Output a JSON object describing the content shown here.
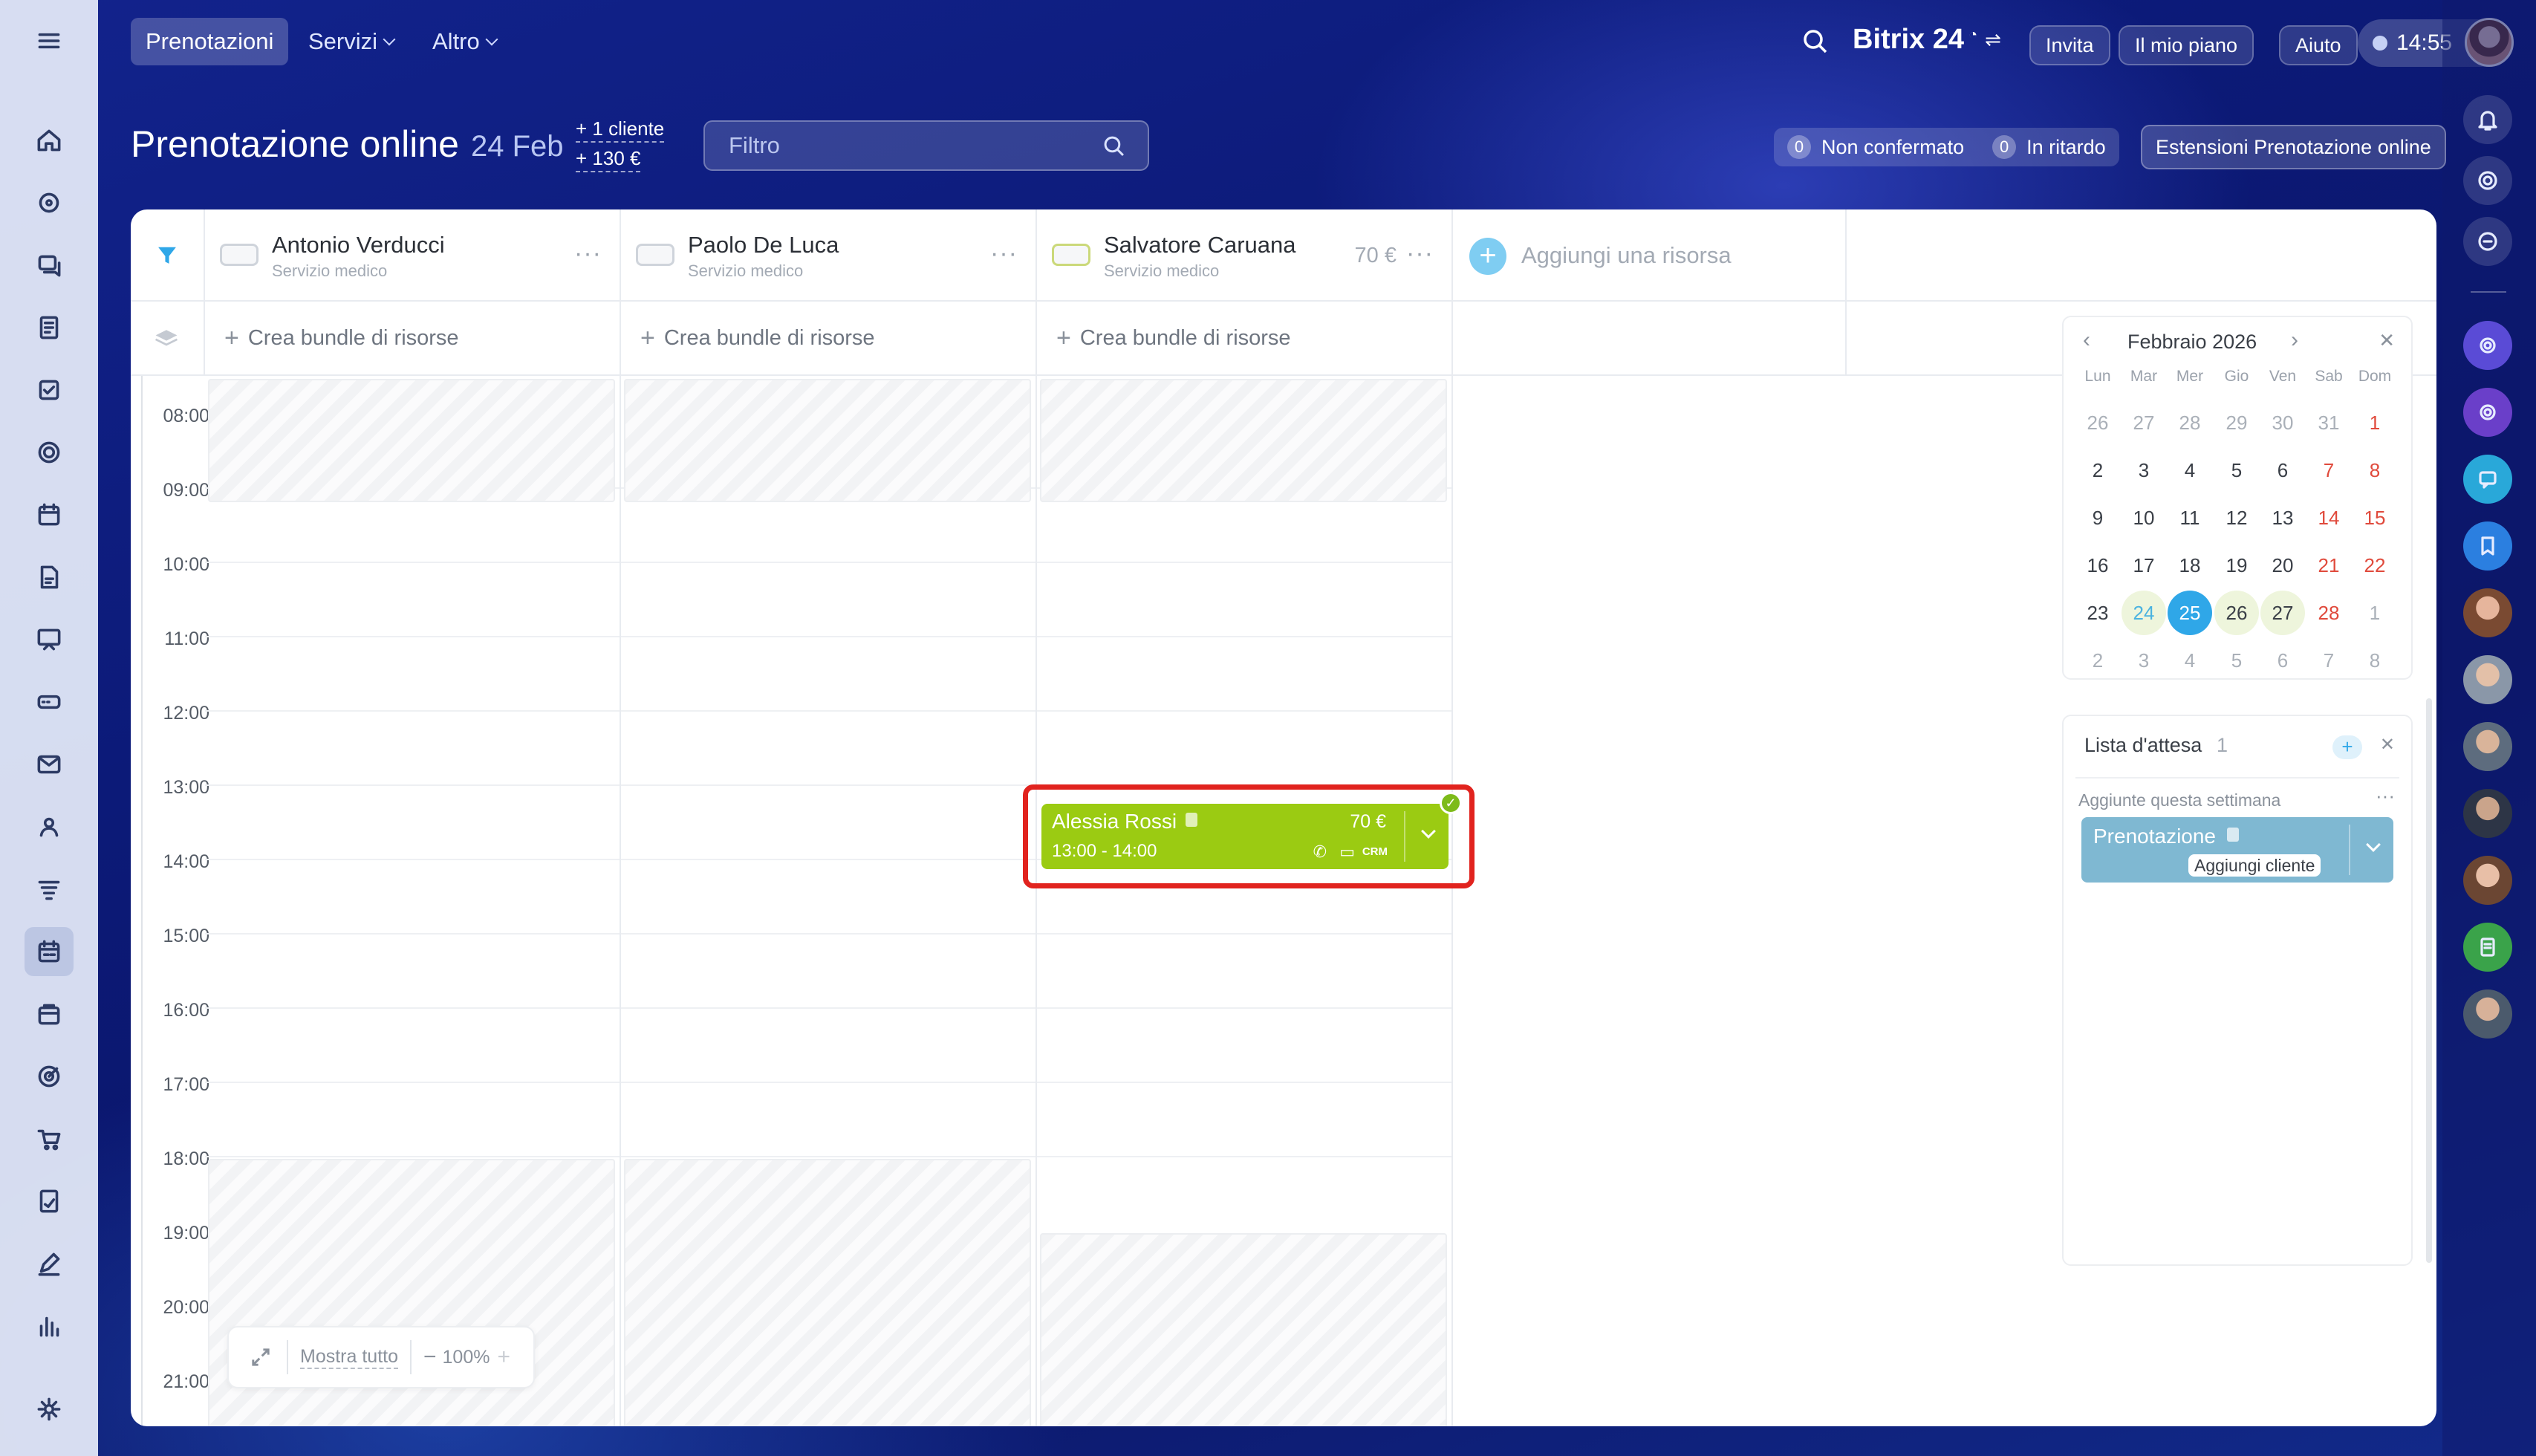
{
  "nav": {
    "tabs": [
      {
        "label": "Prenotazioni"
      },
      {
        "label": "Servizi"
      },
      {
        "label": "Altro"
      }
    ]
  },
  "topbar": {
    "brand": "Bitrix 24",
    "invite": "Invita",
    "plan": "Il mio piano",
    "help": "Aiuto",
    "time": "14:55"
  },
  "header": {
    "title": "Prenotazione online",
    "date": "24 Feb",
    "clients": "+ 1 cliente",
    "revenue": "+ 130 €",
    "filter_placeholder": "Filtro",
    "unconfirmed": {
      "count": "0",
      "label": "Non confermato"
    },
    "late": {
      "count": "0",
      "label": "In ritardo"
    },
    "extensions": "Estensioni Prenotazione online"
  },
  "resources": [
    {
      "name": "Antonio Verducci",
      "type": "Servizio medico",
      "price": ""
    },
    {
      "name": "Paolo De Luca",
      "type": "Servizio medico",
      "price": ""
    },
    {
      "name": "Salvatore Caruana",
      "type": "Servizio medico",
      "price": "70 €"
    }
  ],
  "add_resource": "Aggiungi una risorsa",
  "bundle_label": "Crea bundle di risorse",
  "hours": [
    "08:00",
    "09:00",
    "10:00",
    "11:00",
    "12:00",
    "13:00",
    "14:00",
    "15:00",
    "16:00",
    "17:00",
    "18:00",
    "19:00",
    "20:00",
    "21:00"
  ],
  "booking": {
    "client": "Alessia Rossi",
    "price": "70 €",
    "time": "13:00 - 14:00",
    "crm": "CRM"
  },
  "zoom": {
    "show_all": "Mostra tutto",
    "level": "100%"
  },
  "calendar": {
    "month": "Febbraio 2026",
    "weekdays": [
      "Lun",
      "Mar",
      "Mer",
      "Gio",
      "Ven",
      "Sab",
      "Dom"
    ],
    "weeks": [
      [
        "26",
        "27",
        "28",
        "29",
        "30",
        "31",
        "1"
      ],
      [
        "2",
        "3",
        "4",
        "5",
        "6",
        "7",
        "8"
      ],
      [
        "9",
        "10",
        "11",
        "12",
        "13",
        "14",
        "15"
      ],
      [
        "16",
        "17",
        "18",
        "19",
        "20",
        "21",
        "22"
      ],
      [
        "23",
        "24",
        "25",
        "26",
        "27",
        "28",
        "1"
      ],
      [
        "2",
        "3",
        "4",
        "5",
        "6",
        "7",
        "8"
      ]
    ],
    "today": "25"
  },
  "waitlist": {
    "title": "Lista d'attesa",
    "count": "1",
    "section": "Aggiunte questa settimana",
    "item": "Prenotazione",
    "add_client": "Aggiungi cliente"
  },
  "colors": {
    "booking": "#9bcb12",
    "highlight": "#e1231e",
    "today": "#2fa7e8",
    "waitlist_item": "#7fb8d2"
  }
}
